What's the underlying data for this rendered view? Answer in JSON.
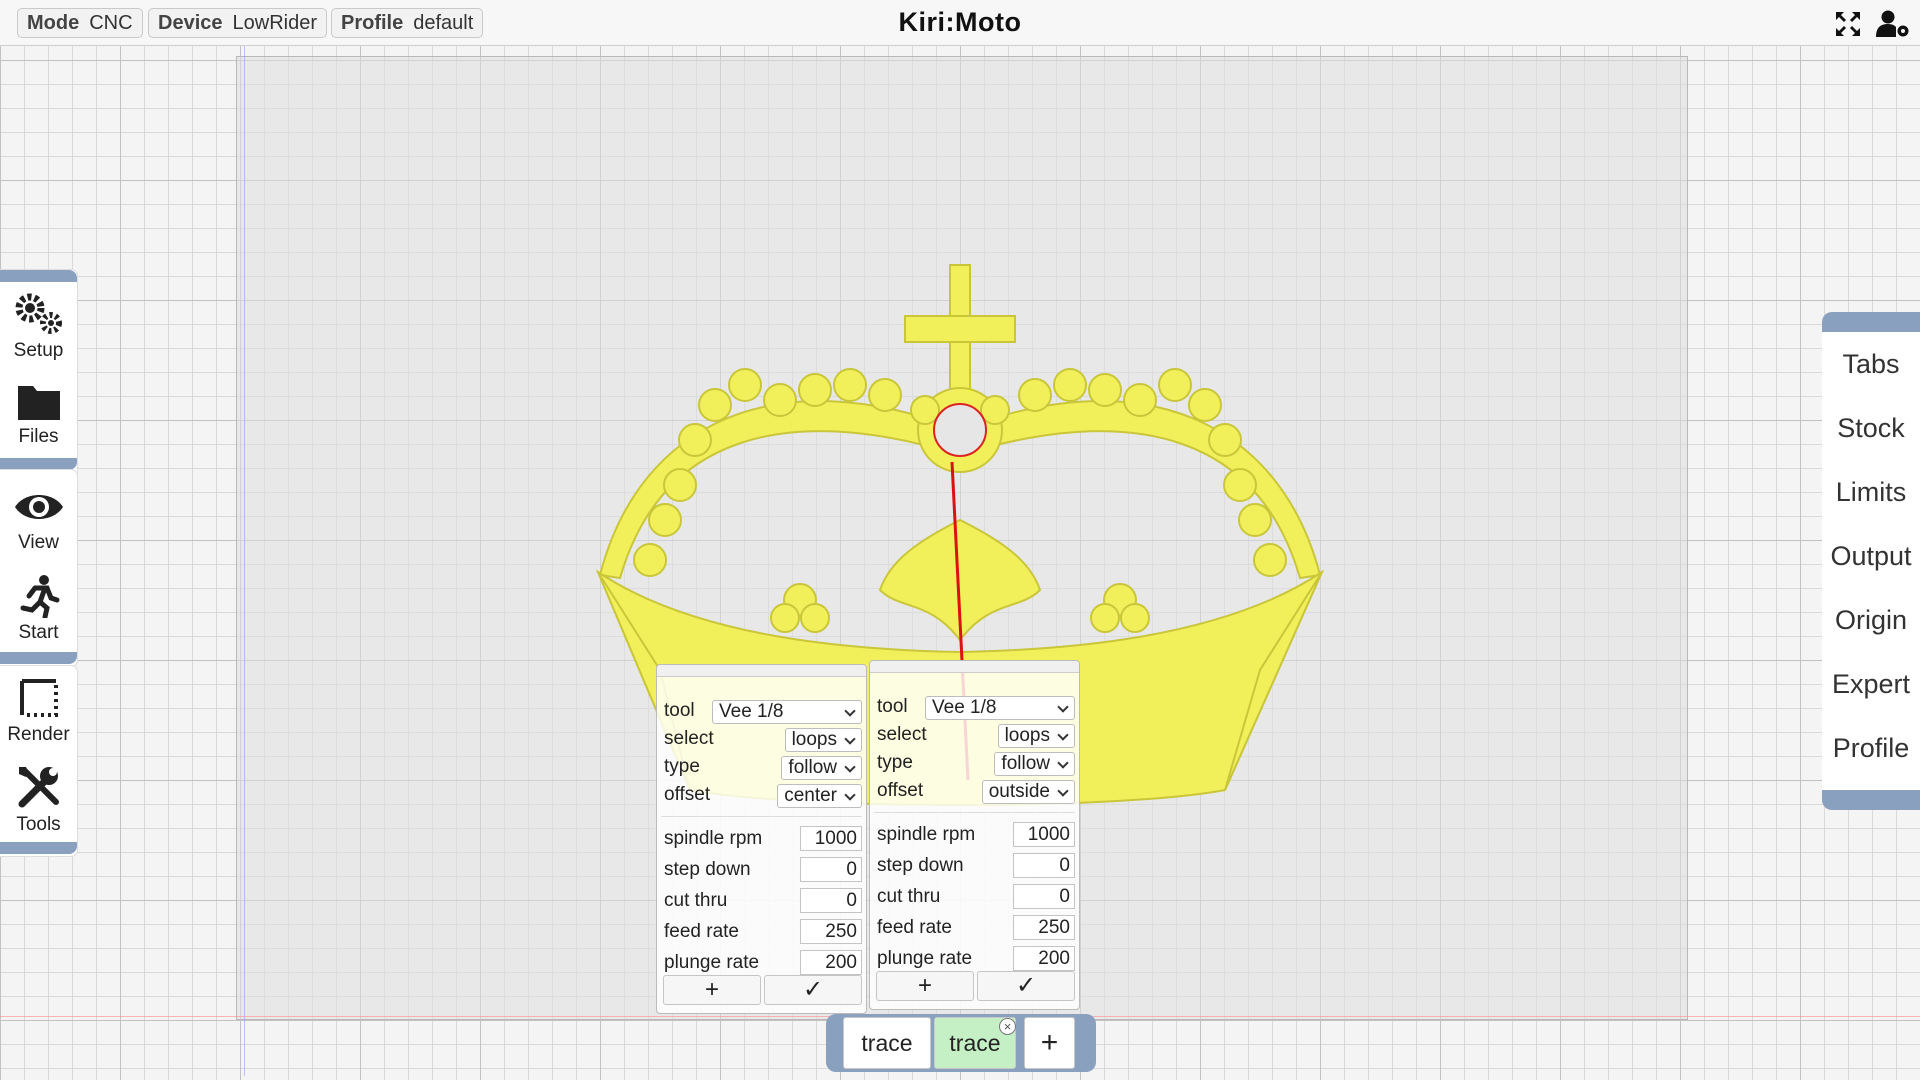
{
  "topbar": {
    "mode_label": "Mode",
    "mode_value": "CNC",
    "device_label": "Device",
    "device_value": "LowRider",
    "profile_label": "Profile",
    "profile_value": "default",
    "title": "Kiri:Moto",
    "icons": [
      "fullscreen-icon",
      "user-settings-icon"
    ]
  },
  "left_toolbar": {
    "setup": "Setup",
    "files": "Files",
    "view": "View",
    "start": "Start",
    "render": "Render",
    "tools": "Tools"
  },
  "right_menu": [
    "Tabs",
    "Stock",
    "Limits",
    "Output",
    "Origin",
    "Expert",
    "Profile"
  ],
  "op_panels": [
    {
      "tool_label": "tool",
      "tool": "Vee 1/8",
      "select_label": "select",
      "select": "loops",
      "type_label": "type",
      "type": "follow",
      "offset_label": "offset",
      "offset": "center",
      "spindle_label": "spindle rpm",
      "spindle": "1000",
      "step_label": "step down",
      "step": "0",
      "cut_label": "cut thru",
      "cut": "0",
      "feed_label": "feed rate",
      "feed": "250",
      "plunge_label": "plunge rate",
      "plunge": "200",
      "add": "+",
      "ok": "✓"
    },
    {
      "tool_label": "tool",
      "tool": "Vee 1/8",
      "select_label": "select",
      "select": "loops",
      "type_label": "type",
      "type": "follow",
      "offset_label": "offset",
      "offset": "outside",
      "spindle_label": "spindle rpm",
      "spindle": "1000",
      "step_label": "step down",
      "step": "0",
      "cut_label": "cut thru",
      "cut": "0",
      "feed_label": "feed rate",
      "feed": "250",
      "plunge_label": "plunge rate",
      "plunge": "200",
      "add": "+",
      "ok": "✓"
    }
  ],
  "op_tabs": {
    "first": "trace",
    "second": "trace",
    "add": "+",
    "close": "×"
  },
  "colors": {
    "accent": "#8aa0bf",
    "model": "#f2f05a",
    "active_tab": "#c5efc5"
  }
}
